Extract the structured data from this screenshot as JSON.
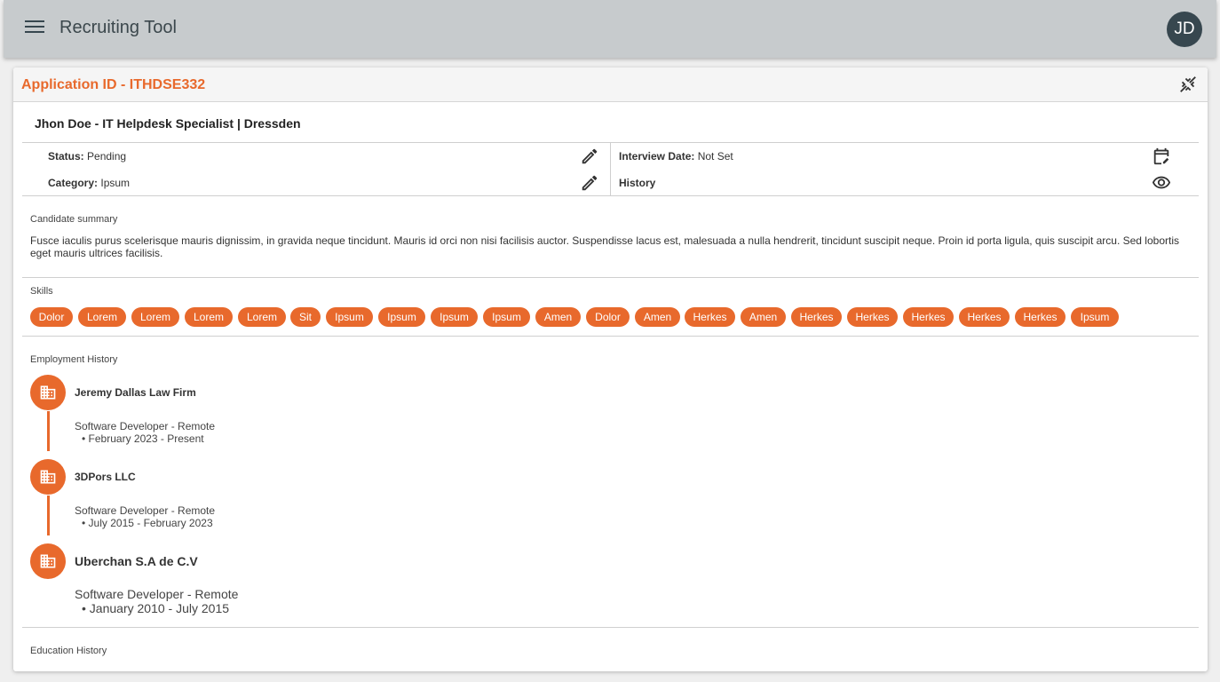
{
  "app": {
    "title": "Recruiting Tool",
    "avatar_initials": "JD",
    "menu_icon": "menu-icon"
  },
  "application": {
    "id_label": "Application ID - ITHDSE332",
    "candidate_title": "Jhon Doe - IT Helpdesk Specialist | Dressden",
    "status_label": "Status:",
    "status_value": "Pending",
    "category_label": "Category:",
    "category_value": "Ipsum",
    "interview_label": "Interview Date:",
    "interview_value": "Not Set",
    "history_label": "History"
  },
  "summary": {
    "label": "Candidate summary",
    "text": "Fusce iaculis purus scelerisque mauris dignissim, in gravida neque tincidunt. Mauris id orci non nisi facilisis auctor. Suspendisse lacus est, malesuada a nulla hendrerit, tincidunt suscipit neque. Proin id porta ligula, quis suscipit arcu. Sed lobortis eget mauris ultrices facilisis."
  },
  "skills": {
    "label": "Skills",
    "items": [
      "Dolor",
      "Lorem",
      "Lorem",
      "Lorem",
      "Lorem",
      "Sit",
      "Ipsum",
      "Ipsum",
      "Ipsum",
      "Ipsum",
      "Amen",
      "Dolor",
      "Amen",
      "Herkes",
      "Amen",
      "Herkes",
      "Herkes",
      "Herkes",
      "Herkes",
      "Herkes",
      "Ipsum"
    ]
  },
  "employment": {
    "label": "Employment History",
    "jobs": [
      {
        "company": "Jeremy Dallas Law Firm",
        "role": "Software Developer -  Remote",
        "period": "February 2023 - Present"
      },
      {
        "company": "3DPors LLC",
        "role": "Software Developer -  Remote",
        "period": "July 2015 - February 2023"
      },
      {
        "company": "Uberchan S.A de C.V",
        "role": "Software Developer -  Remote",
        "period": "January 2010 - July 2015"
      }
    ]
  },
  "education": {
    "label": "Education History"
  },
  "colors": {
    "accent": "#e8692c",
    "appbar": "#c7cbcd",
    "avatar": "#37474f"
  }
}
